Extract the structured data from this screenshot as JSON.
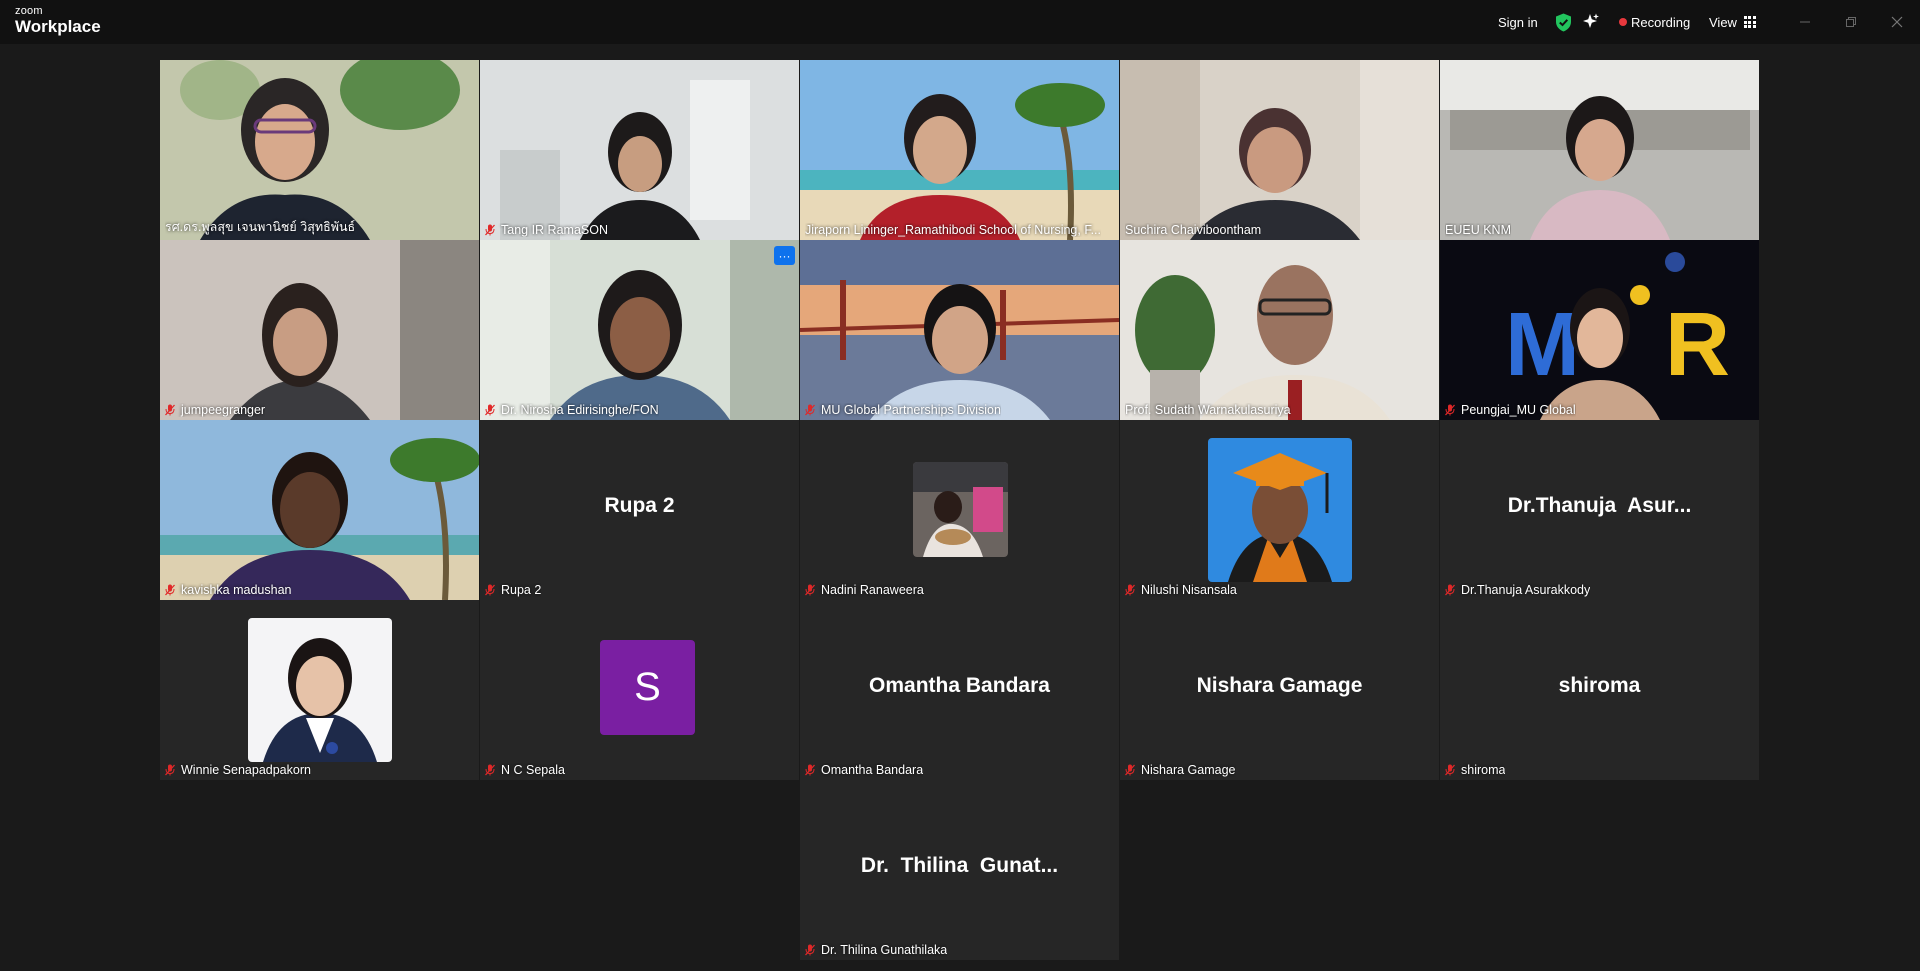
{
  "app": {
    "logo_line1": "zoom",
    "logo_line2": "Workplace"
  },
  "titlebar": {
    "sign_in": "Sign in",
    "recording": "Recording",
    "view": "View"
  },
  "colors": {
    "active_border": "#3fd48d",
    "recording": "#e8383d",
    "tile_bg": "#262626",
    "more_button": "#0e72ed"
  },
  "participants": [
    {
      "name": "รศ.ดร.พูลสุข เจนพานิชย์ วิสุทธิพันธ์",
      "muted": false,
      "active": true
    },
    {
      "name": "Tang IR RamaSON",
      "muted": true
    },
    {
      "name": "Jiraporn Lininger_Ramathibodi School of Nursing, F...",
      "muted": false
    },
    {
      "name": "Suchira Chaiviboontham",
      "muted": false
    },
    {
      "name": "EUEU KNM",
      "muted": false
    },
    {
      "name": "jumpeegranger",
      "muted": true
    },
    {
      "name": "Dr. Nirosha Edirisinghe/FON",
      "muted": true,
      "more": "···"
    },
    {
      "name": "MU Global Partnerships Division",
      "muted": true
    },
    {
      "name": "Prof. Sudath Warnakulasuriya",
      "muted": false
    },
    {
      "name": "Peungjai_MU Global",
      "muted": true
    },
    {
      "name": "kavishka madushan",
      "muted": true
    },
    {
      "name": "Rupa 2",
      "muted": true,
      "display": "Rupa 2"
    },
    {
      "name": "Nadini Ranaweera",
      "muted": true
    },
    {
      "name": "Nilushi Nisansala",
      "muted": true
    },
    {
      "name": "Dr.Thanuja Asurakkody",
      "muted": true,
      "display": "Dr.Thanuja  Asur..."
    },
    {
      "name": "Winnie Senapadpakorn",
      "muted": true
    },
    {
      "name": "N C Sepala",
      "muted": true,
      "letter": "S"
    },
    {
      "name": "Omantha Bandara",
      "muted": true,
      "display": "Omantha Bandara"
    },
    {
      "name": "Nishara Gamage",
      "muted": true,
      "display": "Nishara Gamage"
    },
    {
      "name": "shiroma",
      "muted": true,
      "display": "shiroma"
    },
    {
      "name": "Dr. Thilina Gunathilaka",
      "muted": true,
      "display": "Dr.  Thilina  Gunat..."
    }
  ]
}
